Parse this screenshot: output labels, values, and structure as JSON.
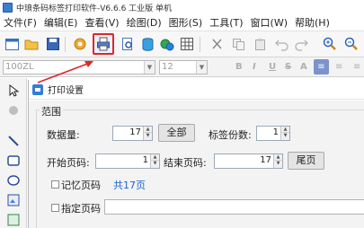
{
  "window": {
    "title": "中琅条码标签打印软件-V6.6.6 工业版 单机"
  },
  "menubar": {
    "items": [
      {
        "label": "文件(F)"
      },
      {
        "label": "编辑(E)"
      },
      {
        "label": "查看(V)"
      },
      {
        "label": "绘图(D)"
      },
      {
        "label": "图形(S)"
      },
      {
        "label": "工具(T)"
      },
      {
        "label": "窗口(W)"
      },
      {
        "label": "帮助(H)"
      }
    ]
  },
  "toolbar": {
    "highlighted_button": "print-settings"
  },
  "fontbar": {
    "font_combo": "100ZL",
    "size_combo": "12",
    "buttons": [
      "B",
      "I",
      "U",
      "S",
      "A"
    ]
  },
  "dialog": {
    "title": "打印设置",
    "range_group": "范围",
    "quantity_label": "数据量:",
    "quantity_value": "17",
    "all_button": "全部",
    "label_copies_label": "标签份数:",
    "label_copies_value": "1",
    "start_page_label": "开始页码:",
    "start_page_value": "1",
    "end_page_label": "结束页码:",
    "end_page_value": "17",
    "last_page_button": "尾页",
    "remember_page_label": "记忆页码",
    "total_pages_text": "共17页",
    "specify_page_label": "指定页码"
  },
  "colors": {
    "highlight": "#e0262b",
    "accent": "#2f7ed6",
    "link": "#1a63c8"
  }
}
